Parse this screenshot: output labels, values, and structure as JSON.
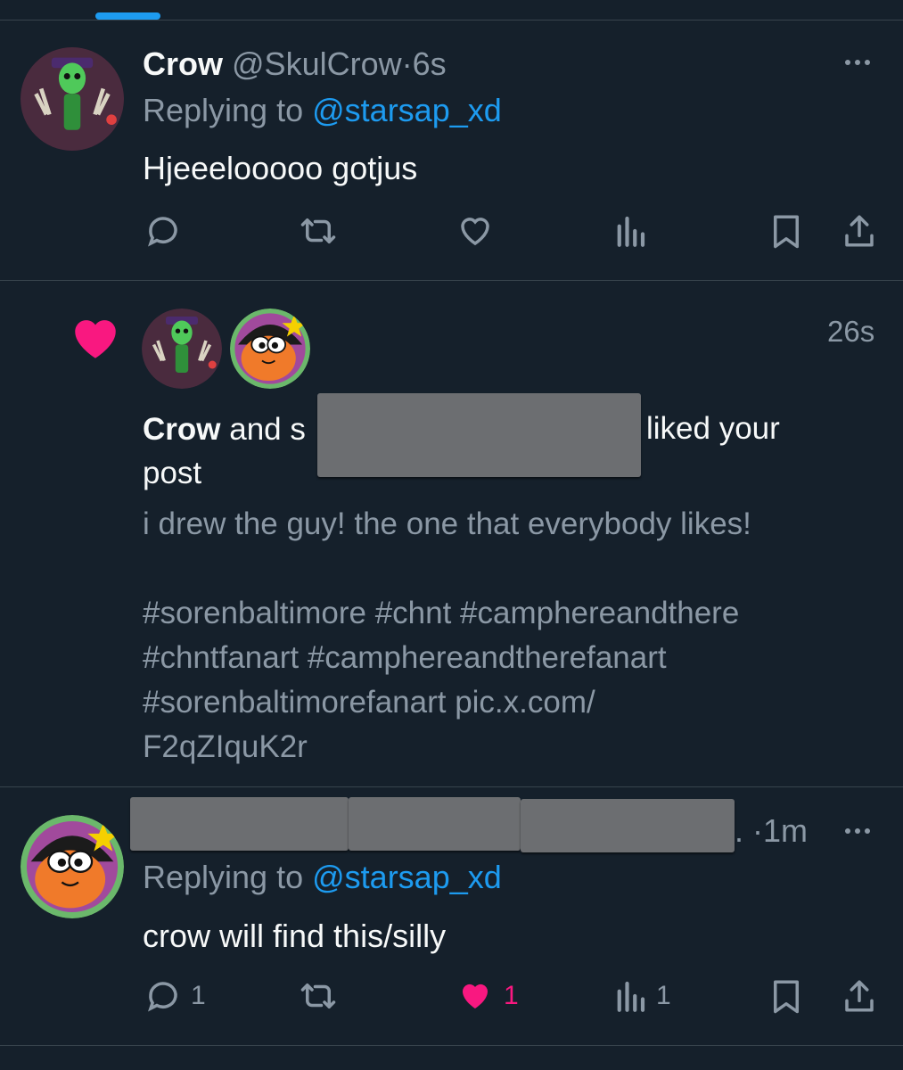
{
  "post1": {
    "display_name": "Crow",
    "handle": "@SkulCrow",
    "separator": "·",
    "time": "6s",
    "replying_label": "Replying to",
    "replying_handle": "@starsap_xd",
    "body": "Hjeeelooooo gotjus",
    "icons": [
      "reply-icon",
      "retweet-icon",
      "like-icon",
      "views-icon",
      "bookmark-icon",
      "share-icon"
    ]
  },
  "notification": {
    "time": "26s",
    "actor": "Crow",
    "and_word": "and",
    "partial_name": "s",
    "liked_text": "liked your",
    "post_word": "post",
    "post_line1": "i drew the guy! the one that everybody likes!",
    "post_line2": "#sorenbaltimore #chnt #camphereandthere",
    "post_line3": "#chntfanart #camphereandtherefanart",
    "post_line4": "#sorenbaltimorefanart pic.x.com/",
    "post_line5": "F2qZIquK2r",
    "icon": "heart-icon",
    "heart_color": "#f91880"
  },
  "post2": {
    "name_trail": ".",
    "separator": "·",
    "time": "1m",
    "replying_label": "Replying to",
    "replying_handle": "@starsap_xd",
    "body": "crow will find this/silly",
    "reply_count": "1",
    "like_count": "1",
    "views_count": "1",
    "like_color": "#f91880"
  },
  "colors": {
    "background": "#15202b",
    "text": "#f7f9f9",
    "muted": "#8b98a5",
    "link": "#1d9bf0",
    "divider": "#38444d"
  }
}
